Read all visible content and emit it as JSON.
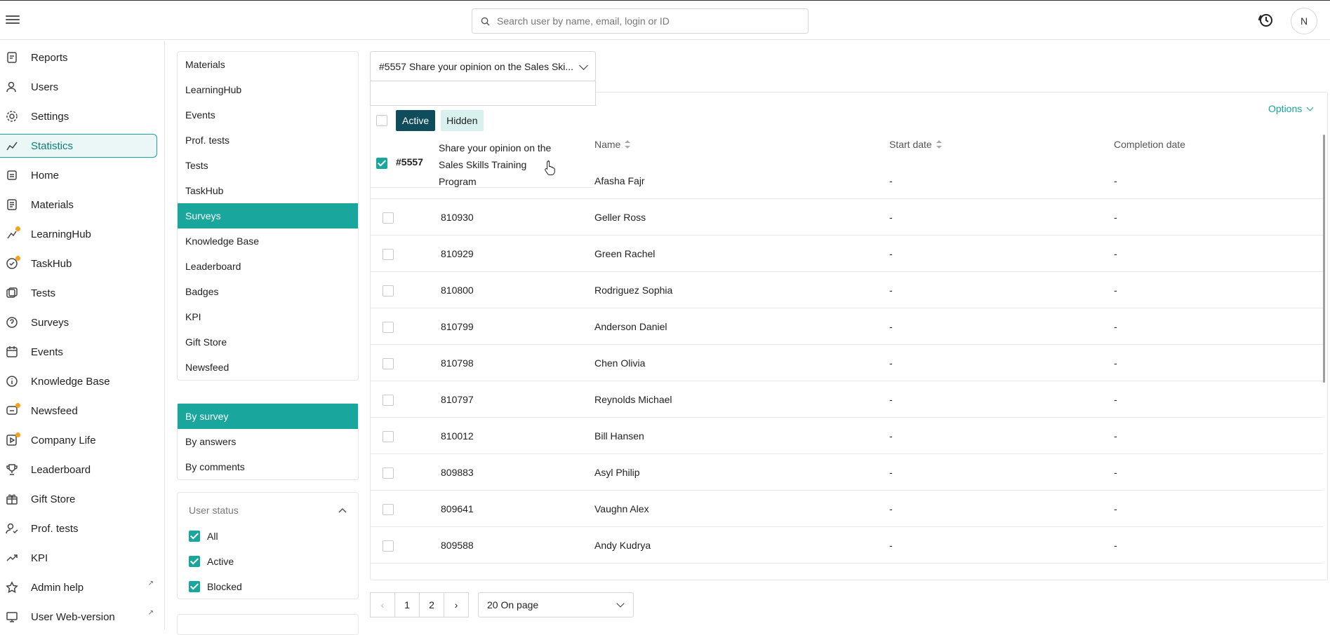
{
  "header": {
    "search_placeholder": "Search user by name, email, login or ID",
    "avatar_initial": "N"
  },
  "sidebar": {
    "items": [
      {
        "label": "Reports",
        "icon": "reports-icon"
      },
      {
        "label": "Users",
        "icon": "users-icon"
      },
      {
        "label": "Settings",
        "icon": "gear-icon"
      },
      {
        "label": "Statistics",
        "icon": "chart-line-icon",
        "active": true
      },
      {
        "label": "Home",
        "icon": "home-icon"
      },
      {
        "label": "Materials",
        "icon": "document-icon"
      },
      {
        "label": "LearningHub",
        "icon": "learninghub-icon",
        "dot": true
      },
      {
        "label": "TaskHub",
        "icon": "taskhub-icon",
        "dot": true
      },
      {
        "label": "Tests",
        "icon": "tests-icon"
      },
      {
        "label": "Surveys",
        "icon": "surveys-icon"
      },
      {
        "label": "Events",
        "icon": "calendar-icon"
      },
      {
        "label": "Knowledge Base",
        "icon": "info-icon"
      },
      {
        "label": "Newsfeed",
        "icon": "newsfeed-icon",
        "dot": true
      },
      {
        "label": "Company Life",
        "icon": "company-life-icon",
        "dot": true
      },
      {
        "label": "Leaderboard",
        "icon": "trophy-icon"
      },
      {
        "label": "Gift Store",
        "icon": "gift-icon"
      },
      {
        "label": "Prof. tests",
        "icon": "prof-tests-icon"
      },
      {
        "label": "KPI",
        "icon": "trend-icon"
      },
      {
        "label": "Admin help",
        "icon": "star-icon",
        "external": true
      },
      {
        "label": "User Web-version",
        "icon": "monitor-icon",
        "external": true
      }
    ]
  },
  "categories": {
    "items": [
      "Materials",
      "LearningHub",
      "Events",
      "Prof. tests",
      "Tests",
      "TaskHub",
      "Surveys",
      "Knowledge Base",
      "Leaderboard",
      "Badges",
      "KPI",
      "Gift Store",
      "Newsfeed"
    ],
    "selected": "Surveys"
  },
  "views": {
    "items": [
      "By survey",
      "By answers",
      "By comments"
    ],
    "selected": "By survey"
  },
  "user_status": {
    "title": "User status",
    "options": [
      {
        "label": "All",
        "checked": true
      },
      {
        "label": "Active",
        "checked": true
      },
      {
        "label": "Blocked",
        "checked": true
      }
    ]
  },
  "survey_select": {
    "value": "#5557 Share your opinion on the Sales Ski..."
  },
  "tabs": {
    "active": "Active",
    "hidden": "Hidden"
  },
  "options_label": "Options",
  "dropdown_item": {
    "id": "#5557",
    "title": "Share your opinion on the Sales Skills Training Program"
  },
  "table": {
    "headers": {
      "name": "Name",
      "start": "Start date",
      "completion": "Completion date"
    },
    "rows": [
      {
        "id": "",
        "name": "Afasha Fajr",
        "start": "-",
        "completion": "-"
      },
      {
        "id": "810930",
        "name": "Geller Ross",
        "start": "-",
        "completion": "-"
      },
      {
        "id": "810929",
        "name": "Green Rachel",
        "start": "-",
        "completion": "-"
      },
      {
        "id": "810800",
        "name": "Rodriguez Sophia",
        "start": "-",
        "completion": "-"
      },
      {
        "id": "810799",
        "name": "Anderson Daniel",
        "start": "-",
        "completion": "-"
      },
      {
        "id": "810798",
        "name": "Chen Olivia",
        "start": "-",
        "completion": "-"
      },
      {
        "id": "810797",
        "name": "Reynolds Michael",
        "start": "-",
        "completion": "-"
      },
      {
        "id": "810012",
        "name": "Bill Hansen",
        "start": "-",
        "completion": "-"
      },
      {
        "id": "809883",
        "name": "Asyl Philip",
        "start": "-",
        "completion": "-"
      },
      {
        "id": "809641",
        "name": "Vaughn Alex",
        "start": "-",
        "completion": "-"
      },
      {
        "id": "809588",
        "name": "Andy Kudrya",
        "start": "-",
        "completion": "-"
      }
    ]
  },
  "pagination": {
    "pages": [
      "1",
      "2"
    ],
    "per_page": "20 On page"
  },
  "colors": {
    "accent": "#19a69c",
    "tab_active": "#0f4c5c",
    "tab_hidden": "#d8f0ee",
    "dot": "#f6a21a"
  }
}
